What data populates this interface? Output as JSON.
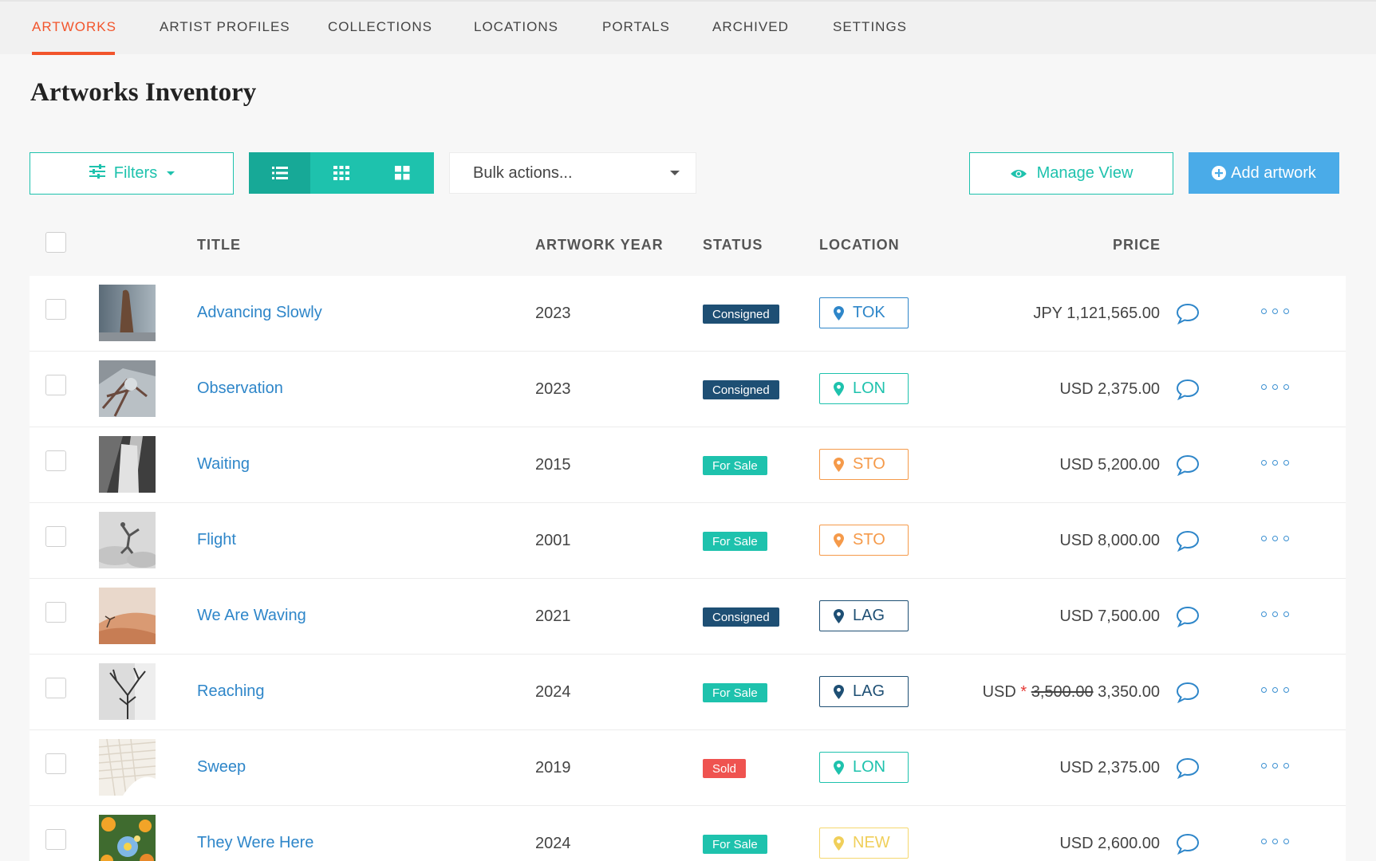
{
  "nav": {
    "tabs": [
      {
        "label": "ARTWORKS",
        "active": true
      },
      {
        "label": "ARTIST PROFILES"
      },
      {
        "label": "COLLECTIONS"
      },
      {
        "label": "LOCATIONS"
      },
      {
        "label": "PORTALS"
      },
      {
        "label": "ARCHIVED"
      },
      {
        "label": "SETTINGS"
      }
    ]
  },
  "page": {
    "title": "Artworks Inventory"
  },
  "toolbar": {
    "filters_label": "Filters",
    "bulk_label": "Bulk actions...",
    "manage_view_label": "Manage View",
    "add_label": "Add artwork",
    "view_modes": [
      "list-icon",
      "grid-small-icon",
      "grid-large-icon"
    ],
    "active_view": "list"
  },
  "table": {
    "headers": {
      "title": "TITLE",
      "year": "ARTWORK YEAR",
      "status": "STATUS",
      "location": "LOCATION",
      "price": "PRICE"
    },
    "rows": [
      {
        "title": "Advancing Slowly",
        "year": "2023",
        "status": "Consigned",
        "location": "TOK",
        "price": "JPY 1,121,565.00"
      },
      {
        "title": "Observation",
        "year": "2023",
        "status": "Consigned",
        "location": "LON",
        "price": "USD 2,375.00"
      },
      {
        "title": "Waiting",
        "year": "2015",
        "status": "For Sale",
        "location": "STO",
        "price": "USD 5,200.00"
      },
      {
        "title": "Flight",
        "year": "2001",
        "status": "For Sale",
        "location": "STO",
        "price": "USD 8,000.00"
      },
      {
        "title": "We Are Waving",
        "year": "2021",
        "status": "Consigned",
        "location": "LAG",
        "price": "USD 7,500.00"
      },
      {
        "title": "Reaching",
        "year": "2024",
        "status": "For Sale",
        "location": "LAG",
        "price_currency": "USD",
        "price_marker": "*",
        "price_old": "3,500.00",
        "price_new": "3,350.00"
      },
      {
        "title": "Sweep",
        "year": "2019",
        "status": "Sold",
        "location": "LON",
        "price": "USD 2,375.00"
      },
      {
        "title": "They Were Here",
        "year": "2024",
        "status": "For Sale",
        "location": "NEW",
        "price": "USD 2,600.00"
      }
    ]
  },
  "colors": {
    "accent_orange": "#f2552c",
    "teal": "#1ec2ad",
    "blue": "#4aabe8",
    "link": "#2e86c9",
    "status": {
      "Consigned": "#1e4f74",
      "For Sale": "#1ec2ad",
      "Sold": "#ef5350"
    },
    "location": {
      "TOK": "#2e86c9",
      "LON": "#1ec2ad",
      "STO": "#f59a4a",
      "LAG": "#1e4f74",
      "NEW": "#f5d76e"
    }
  }
}
